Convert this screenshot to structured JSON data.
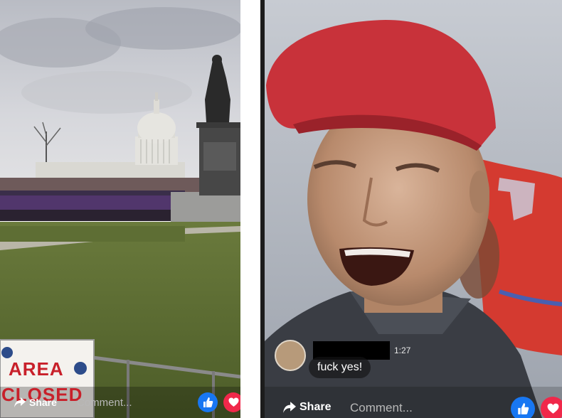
{
  "left_stream": {
    "sign_lines": [
      "AREA",
      "CLOSED"
    ],
    "share_label": "Share",
    "comment_placeholder": "Comment...",
    "reactions": [
      "like-icon",
      "love-icon"
    ]
  },
  "right_stream": {
    "comment": {
      "timestamp": "1:27",
      "text": "fuck yes!"
    },
    "share_label": "Share",
    "comment_placeholder": "Comment...",
    "reactions": [
      "like-icon",
      "love-icon"
    ]
  },
  "colors": {
    "like_blue": "#1877f2",
    "love_red": "#f0284a",
    "cap_red": "#c8323a",
    "flag_red": "#d43a30"
  }
}
